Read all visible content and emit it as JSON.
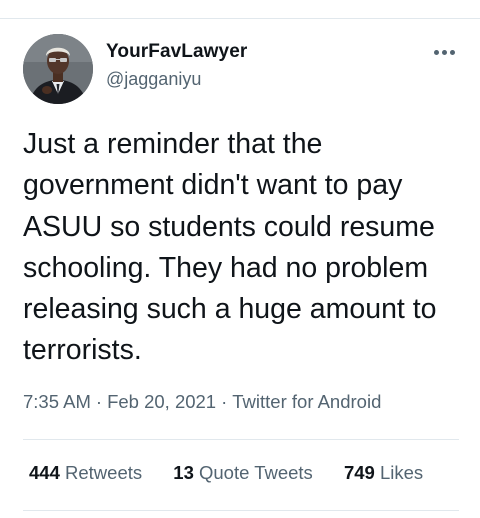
{
  "tweet": {
    "author_name": "YourFavLawyer",
    "author_handle": "@jagganiyu",
    "text": "Just a reminder that the government didn't want to pay ASUU so students could resume schooling. They had no problem releasing such a huge amount to terrorists.",
    "time": "7:35 AM",
    "date": "Feb 20, 2021",
    "meta_separator": "·",
    "source": "Twitter for Android"
  },
  "stats": {
    "retweets_count": "444",
    "retweets_label": "Retweets",
    "quote_count": "13",
    "quote_label": "Quote Tweets",
    "likes_count": "749",
    "likes_label": "Likes"
  },
  "icons": {
    "more": "more-options-icon"
  },
  "colors": {
    "text": "#0f1419",
    "secondary": "#536471",
    "divider": "#e1e8ed"
  }
}
